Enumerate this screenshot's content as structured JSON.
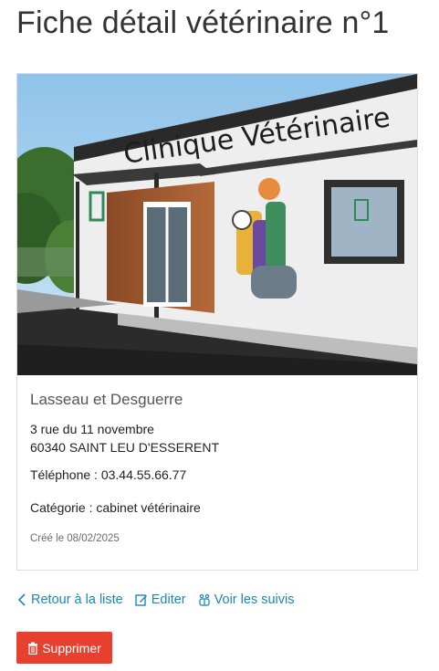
{
  "page": {
    "title": "Fiche détail vétérinaire n°1"
  },
  "photo": {
    "sign_text": "Clinique Vétérinaire"
  },
  "vet": {
    "name": "Lasseau et Desguerre",
    "address_line1": "3 rue du 11 novembre",
    "address_line2": "60340 SAINT LEU D'ESSERENT",
    "phone": "Téléphone : 03.44.55.66.77",
    "category": "Catégorie : cabinet vétérinaire",
    "created": "Créé le 08/02/2025"
  },
  "actions": {
    "back_label": "Retour à la liste",
    "edit_label": "Editer",
    "followups_label": "Voir les suivis",
    "delete_label": "Supprimer"
  },
  "icons": {
    "back": "chevron-left-icon",
    "edit": "edit-icon",
    "followups": "pets-icon",
    "delete": "trash-icon"
  },
  "colors": {
    "link": "#1a88b8",
    "danger": "#e8402f"
  }
}
